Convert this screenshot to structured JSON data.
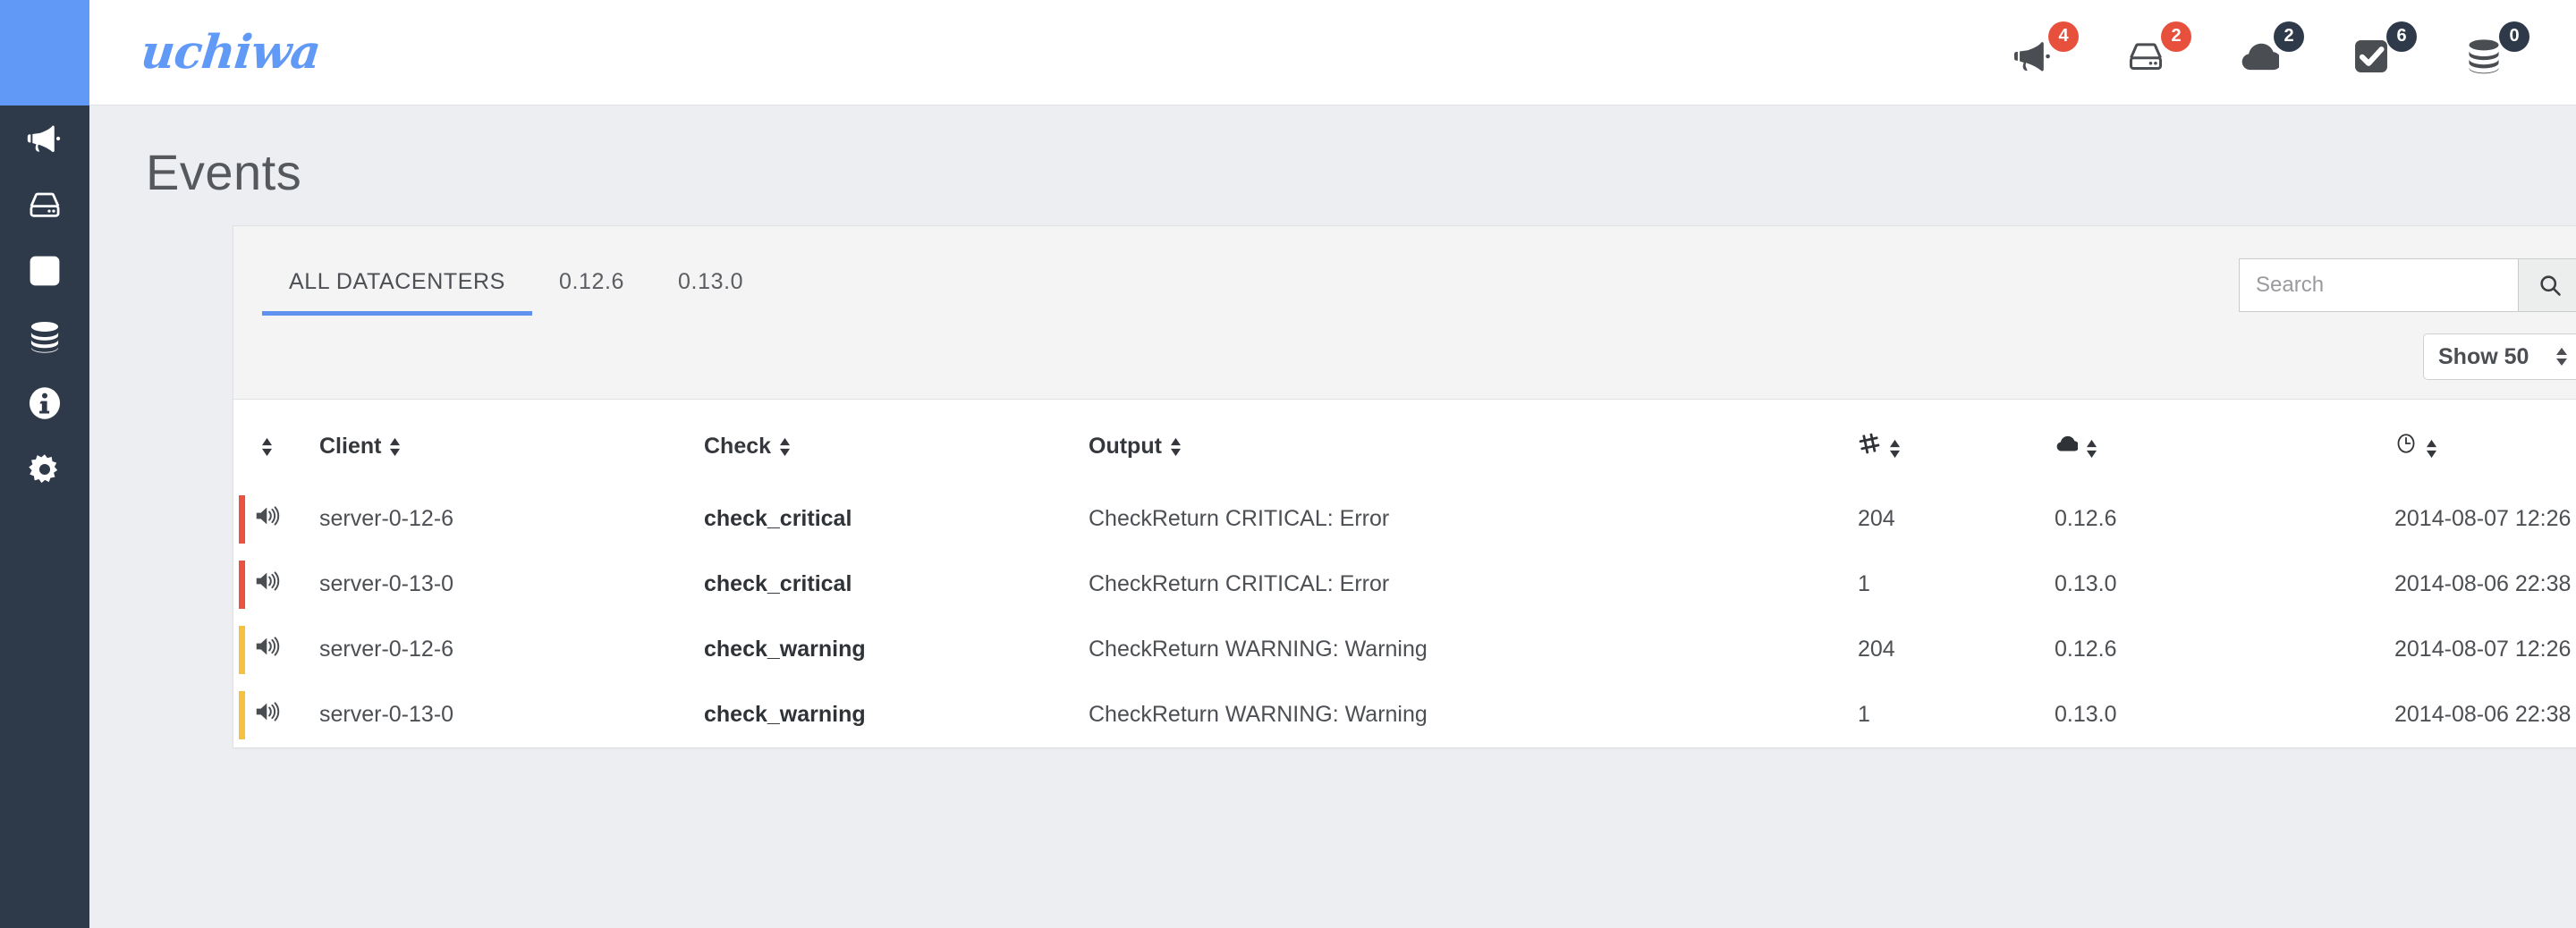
{
  "brand": {
    "name": "uchiwa",
    "color": "#6199f7"
  },
  "topbar": {
    "icons": [
      {
        "name": "megaphone-icon",
        "badge": "4",
        "badge_style": "red"
      },
      {
        "name": "server-icon",
        "badge": "2",
        "badge_style": "red"
      },
      {
        "name": "cloud-icon",
        "badge": "2",
        "badge_style": "navy"
      },
      {
        "name": "check-square-icon",
        "badge": "6",
        "badge_style": "navy"
      },
      {
        "name": "stack-icon",
        "badge": "0",
        "badge_style": "navy"
      }
    ]
  },
  "sidebar": {
    "items": [
      {
        "name": "megaphone-icon"
      },
      {
        "name": "server-icon"
      },
      {
        "name": "check-square-icon"
      },
      {
        "name": "stack-icon"
      },
      {
        "name": "info-icon"
      },
      {
        "name": "gear-icon"
      }
    ]
  },
  "page": {
    "title": "Events"
  },
  "tabs": [
    {
      "label": "ALL DATACENTERS",
      "active": true
    },
    {
      "label": "0.12.6",
      "active": false
    },
    {
      "label": "0.13.0",
      "active": false
    }
  ],
  "search": {
    "placeholder": "Search",
    "value": "",
    "icon": "search-icon"
  },
  "show_select": {
    "label": "Show 50",
    "icon": "updown-arrows-icon"
  },
  "table": {
    "columns": [
      {
        "key": "status",
        "label": "",
        "icon": null,
        "sortable": true
      },
      {
        "key": "client",
        "label": "Client",
        "icon": null,
        "sortable": true
      },
      {
        "key": "check",
        "label": "Check",
        "icon": null,
        "sortable": true
      },
      {
        "key": "output",
        "label": "Output",
        "icon": null,
        "sortable": true
      },
      {
        "key": "occurrences",
        "label": "",
        "icon": "hash-icon",
        "sortable": true
      },
      {
        "key": "datacenter",
        "label": "",
        "icon": "cloud-icon",
        "sortable": true
      },
      {
        "key": "timestamp",
        "label": "",
        "icon": "clock-icon",
        "sortable": true
      }
    ],
    "rows": [
      {
        "severity": "critical",
        "icon": "speaker-icon",
        "client": "server-0-12-6",
        "check": "check_critical",
        "output": "CheckReturn CRITICAL: Error",
        "occurrences": "204",
        "datacenter": "0.12.6",
        "timestamp": "2014-08-07 12:26"
      },
      {
        "severity": "critical",
        "icon": "speaker-icon",
        "client": "server-0-13-0",
        "check": "check_critical",
        "output": "CheckReturn CRITICAL: Error",
        "occurrences": "1",
        "datacenter": "0.13.0",
        "timestamp": "2014-08-06 22:38"
      },
      {
        "severity": "warning",
        "icon": "speaker-icon",
        "client": "server-0-12-6",
        "check": "check_warning",
        "output": "CheckReturn WARNING: Warning",
        "occurrences": "204",
        "datacenter": "0.12.6",
        "timestamp": "2014-08-07 12:26"
      },
      {
        "severity": "warning",
        "icon": "speaker-icon",
        "client": "server-0-13-0",
        "check": "check_warning",
        "output": "CheckReturn WARNING: Warning",
        "occurrences": "1",
        "datacenter": "0.13.0",
        "timestamp": "2014-08-06 22:38"
      }
    ]
  },
  "colors": {
    "accent_blue": "#6199f7",
    "sidebar_navy": "#2e3a4a",
    "critical_red": "#ea5241",
    "warning_amber": "#f7c140",
    "page_background": "#edeef1"
  }
}
